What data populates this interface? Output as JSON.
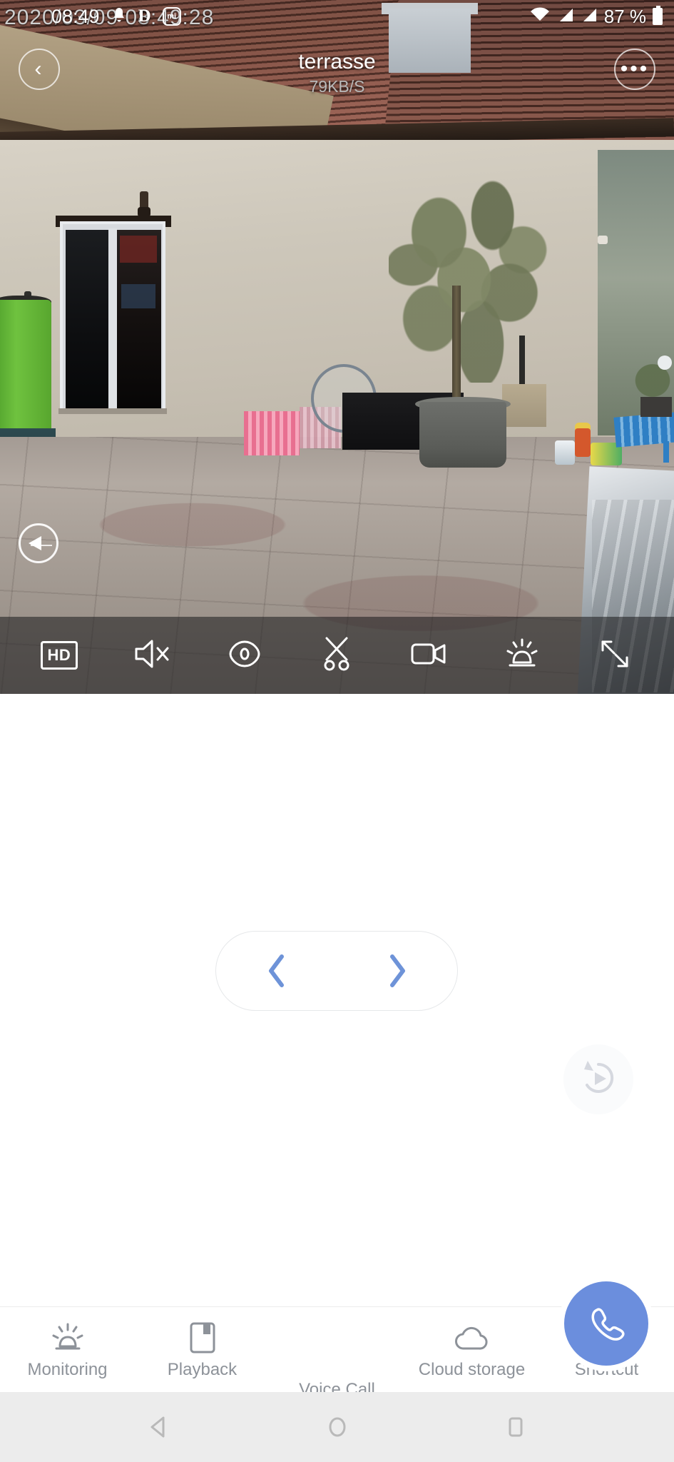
{
  "status_bar": {
    "clock": "08:49",
    "battery_percent": "87 %",
    "icons": [
      "bell-icon",
      "dnd-icon",
      "mi-account-icon",
      "wifi-icon",
      "signal-icon",
      "signal-icon-2",
      "battery-icon"
    ],
    "dnd_label": "D",
    "mi_label": "mi"
  },
  "camera_osd": {
    "timestamp": "2020/03/09  08:49:28"
  },
  "video_header": {
    "back_label": "‹",
    "title": "terrasse",
    "bitrate": "79KB/S",
    "more_label": "•••"
  },
  "video_controls": {
    "items": [
      {
        "name": "quality-hd-button",
        "label": "HD",
        "icon": "hd-icon"
      },
      {
        "name": "mute-button",
        "label": "",
        "icon": "speaker-mute-icon"
      },
      {
        "name": "view-button",
        "label": "",
        "icon": "eye-icon"
      },
      {
        "name": "clip-button",
        "label": "",
        "icon": "scissors-icon"
      },
      {
        "name": "record-button",
        "label": "",
        "icon": "video-camera-icon"
      },
      {
        "name": "alarm-button",
        "label": "",
        "icon": "siren-icon"
      },
      {
        "name": "fullscreen-button",
        "label": "",
        "icon": "expand-icon"
      }
    ]
  },
  "ptz": {
    "name": "ptz-dial",
    "icon": "pan-left-icon"
  },
  "content": {
    "nav_prev": "‹",
    "nav_next": "›",
    "replay_icon": "replay-icon"
  },
  "tabbar": {
    "items": [
      {
        "label": "Monitoring",
        "icon": "siren-icon",
        "active": false
      },
      {
        "label": "Playback",
        "icon": "save-floppy-icon",
        "active": false
      },
      {
        "label": "Voice Call",
        "icon": "phone-icon",
        "active": true
      },
      {
        "label": "Cloud storage",
        "icon": "cloud-icon",
        "active": false
      },
      {
        "label": "Shortcut",
        "icon": "hamburger-icon",
        "active": false
      }
    ]
  },
  "android_nav": {
    "back": "back-triangle-icon",
    "home": "home-circle-icon",
    "recents": "recents-square-icon"
  },
  "colors": {
    "accent_blue": "#6b8edd",
    "pill_chevron_blue": "#6e93d8",
    "tab_label_gray": "#8d9299",
    "video_overlay": "rgba(25,25,28,0.55)"
  }
}
